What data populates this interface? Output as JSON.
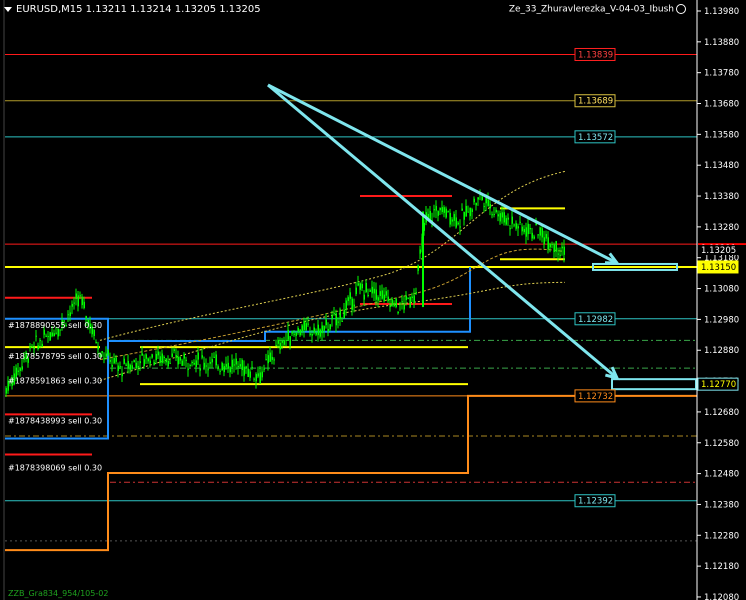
{
  "header": {
    "symbol_info": "EURUSD,M15  1.13211 1.13214 1.13205 1.13205",
    "expert_name": "Ze_33_Zhuravlerezka_V-04-03_Ibush"
  },
  "colors": {
    "background": "#000000",
    "axis": "#ffffff",
    "candle": "#00ff00",
    "red_line": "#ff1a1a",
    "yellow_line": "#ffff00",
    "gold_line": "#b09a2a",
    "cyan_line": "#2ec4c4",
    "blue_line": "#1e90ff",
    "orange_line": "#ff8c1a",
    "arrow": "#7fe6ee"
  },
  "price_axis": {
    "ticks": [
      "1.13980",
      "1.13880",
      "1.13780",
      "1.13680",
      "1.13580",
      "1.13480",
      "1.13380",
      "1.13280",
      "1.13180",
      "1.13080",
      "1.12980",
      "1.12880",
      "1.12780",
      "1.12680",
      "1.12580",
      "1.12480",
      "1.12380",
      "1.12280",
      "1.12180",
      "1.12080"
    ],
    "current_price": "1.13205",
    "current_bid_red": "1.13211",
    "current_sub": "1.13180"
  },
  "level_labels": [
    {
      "text": "1.13839",
      "price": 1.13839,
      "style": "red"
    },
    {
      "text": "1.13689",
      "price": 1.13689,
      "style": "gold"
    },
    {
      "text": "1.13572",
      "price": 1.13572,
      "style": "cyan"
    },
    {
      "text": "1.13150",
      "price": 1.1315,
      "style": "yellow"
    },
    {
      "text": "1.12982",
      "price": 1.12982,
      "style": "cyan"
    },
    {
      "text": "1.12770",
      "price": 1.1277,
      "style": "cyan-box"
    },
    {
      "text": "1.12732",
      "price": 1.12732,
      "style": "orange"
    },
    {
      "text": "1.12392",
      "price": 1.12392,
      "style": "cyan"
    }
  ],
  "order_labels": [
    {
      "text": "#1878890555 sell 0.30",
      "price": 1.12962
    },
    {
      "text": "#1878578795 sell 0.30",
      "price": 1.12862
    },
    {
      "text": "#1878591863 sell 0.30",
      "price": 1.12782
    },
    {
      "text": "#1878438993 sell 0.30",
      "price": 1.12652
    },
    {
      "text": "#1878398069 sell 0.30",
      "price": 1.125
    }
  ],
  "bottom_tag": "ZZB_Gra834_954/105-02"
}
